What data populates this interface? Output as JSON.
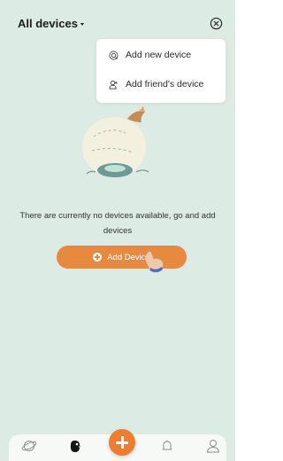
{
  "header": {
    "title": "All devices"
  },
  "menu": {
    "items": [
      {
        "label": "Add new device",
        "icon": "add-device-icon"
      },
      {
        "label": "Add friend's device",
        "icon": "friend-icon"
      }
    ]
  },
  "empty_state": {
    "message": "There are currently no devices available, go and add devices",
    "button_label": "Add Device"
  },
  "bottom_nav": {
    "items": [
      {
        "name": "planet-icon"
      },
      {
        "name": "devices-icon",
        "active": true
      },
      {
        "name": "add-icon"
      },
      {
        "name": "bell-icon"
      },
      {
        "name": "profile-icon"
      }
    ]
  },
  "colors": {
    "background": "#dcebe4",
    "accent": "#e78a3f",
    "fab": "#ec7d33"
  }
}
